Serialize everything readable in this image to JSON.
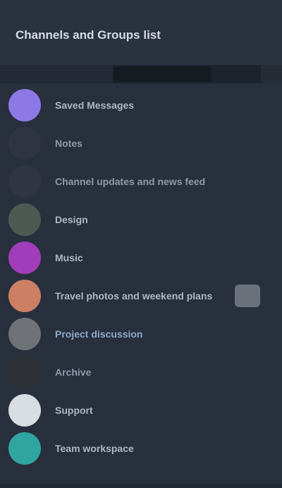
{
  "header": {
    "title": "Channels and Groups list"
  },
  "subbar": {
    "tab_label": ""
  },
  "items": [
    {
      "label": "Saved Messages",
      "avatar_color": "#8c79e6",
      "label_style": ""
    },
    {
      "label": "Notes",
      "avatar_color": "#2f3540",
      "label_style": "dim"
    },
    {
      "label": "Channel updates and news feed",
      "avatar_color": "#303641",
      "label_style": "dim"
    },
    {
      "label": "Design",
      "avatar_color": "#4d5a52",
      "label_style": ""
    },
    {
      "label": "Music",
      "avatar_color": "#a13dba",
      "label_style": ""
    },
    {
      "label": "Travel photos and weekend plans",
      "avatar_color": "#cc7f63",
      "label_style": ""
    },
    {
      "label": "Project discussion",
      "avatar_color": "#6f7378",
      "label_style": "blue"
    },
    {
      "label": "Archive",
      "avatar_color": "#2d2f36",
      "label_style": "dim"
    },
    {
      "label": "Support",
      "avatar_color": "#d8dde3",
      "label_style": ""
    },
    {
      "label": "Team workspace",
      "avatar_color": "#2fa6a0",
      "label_style": ""
    }
  ],
  "badge": {
    "color": "#6b717b"
  }
}
